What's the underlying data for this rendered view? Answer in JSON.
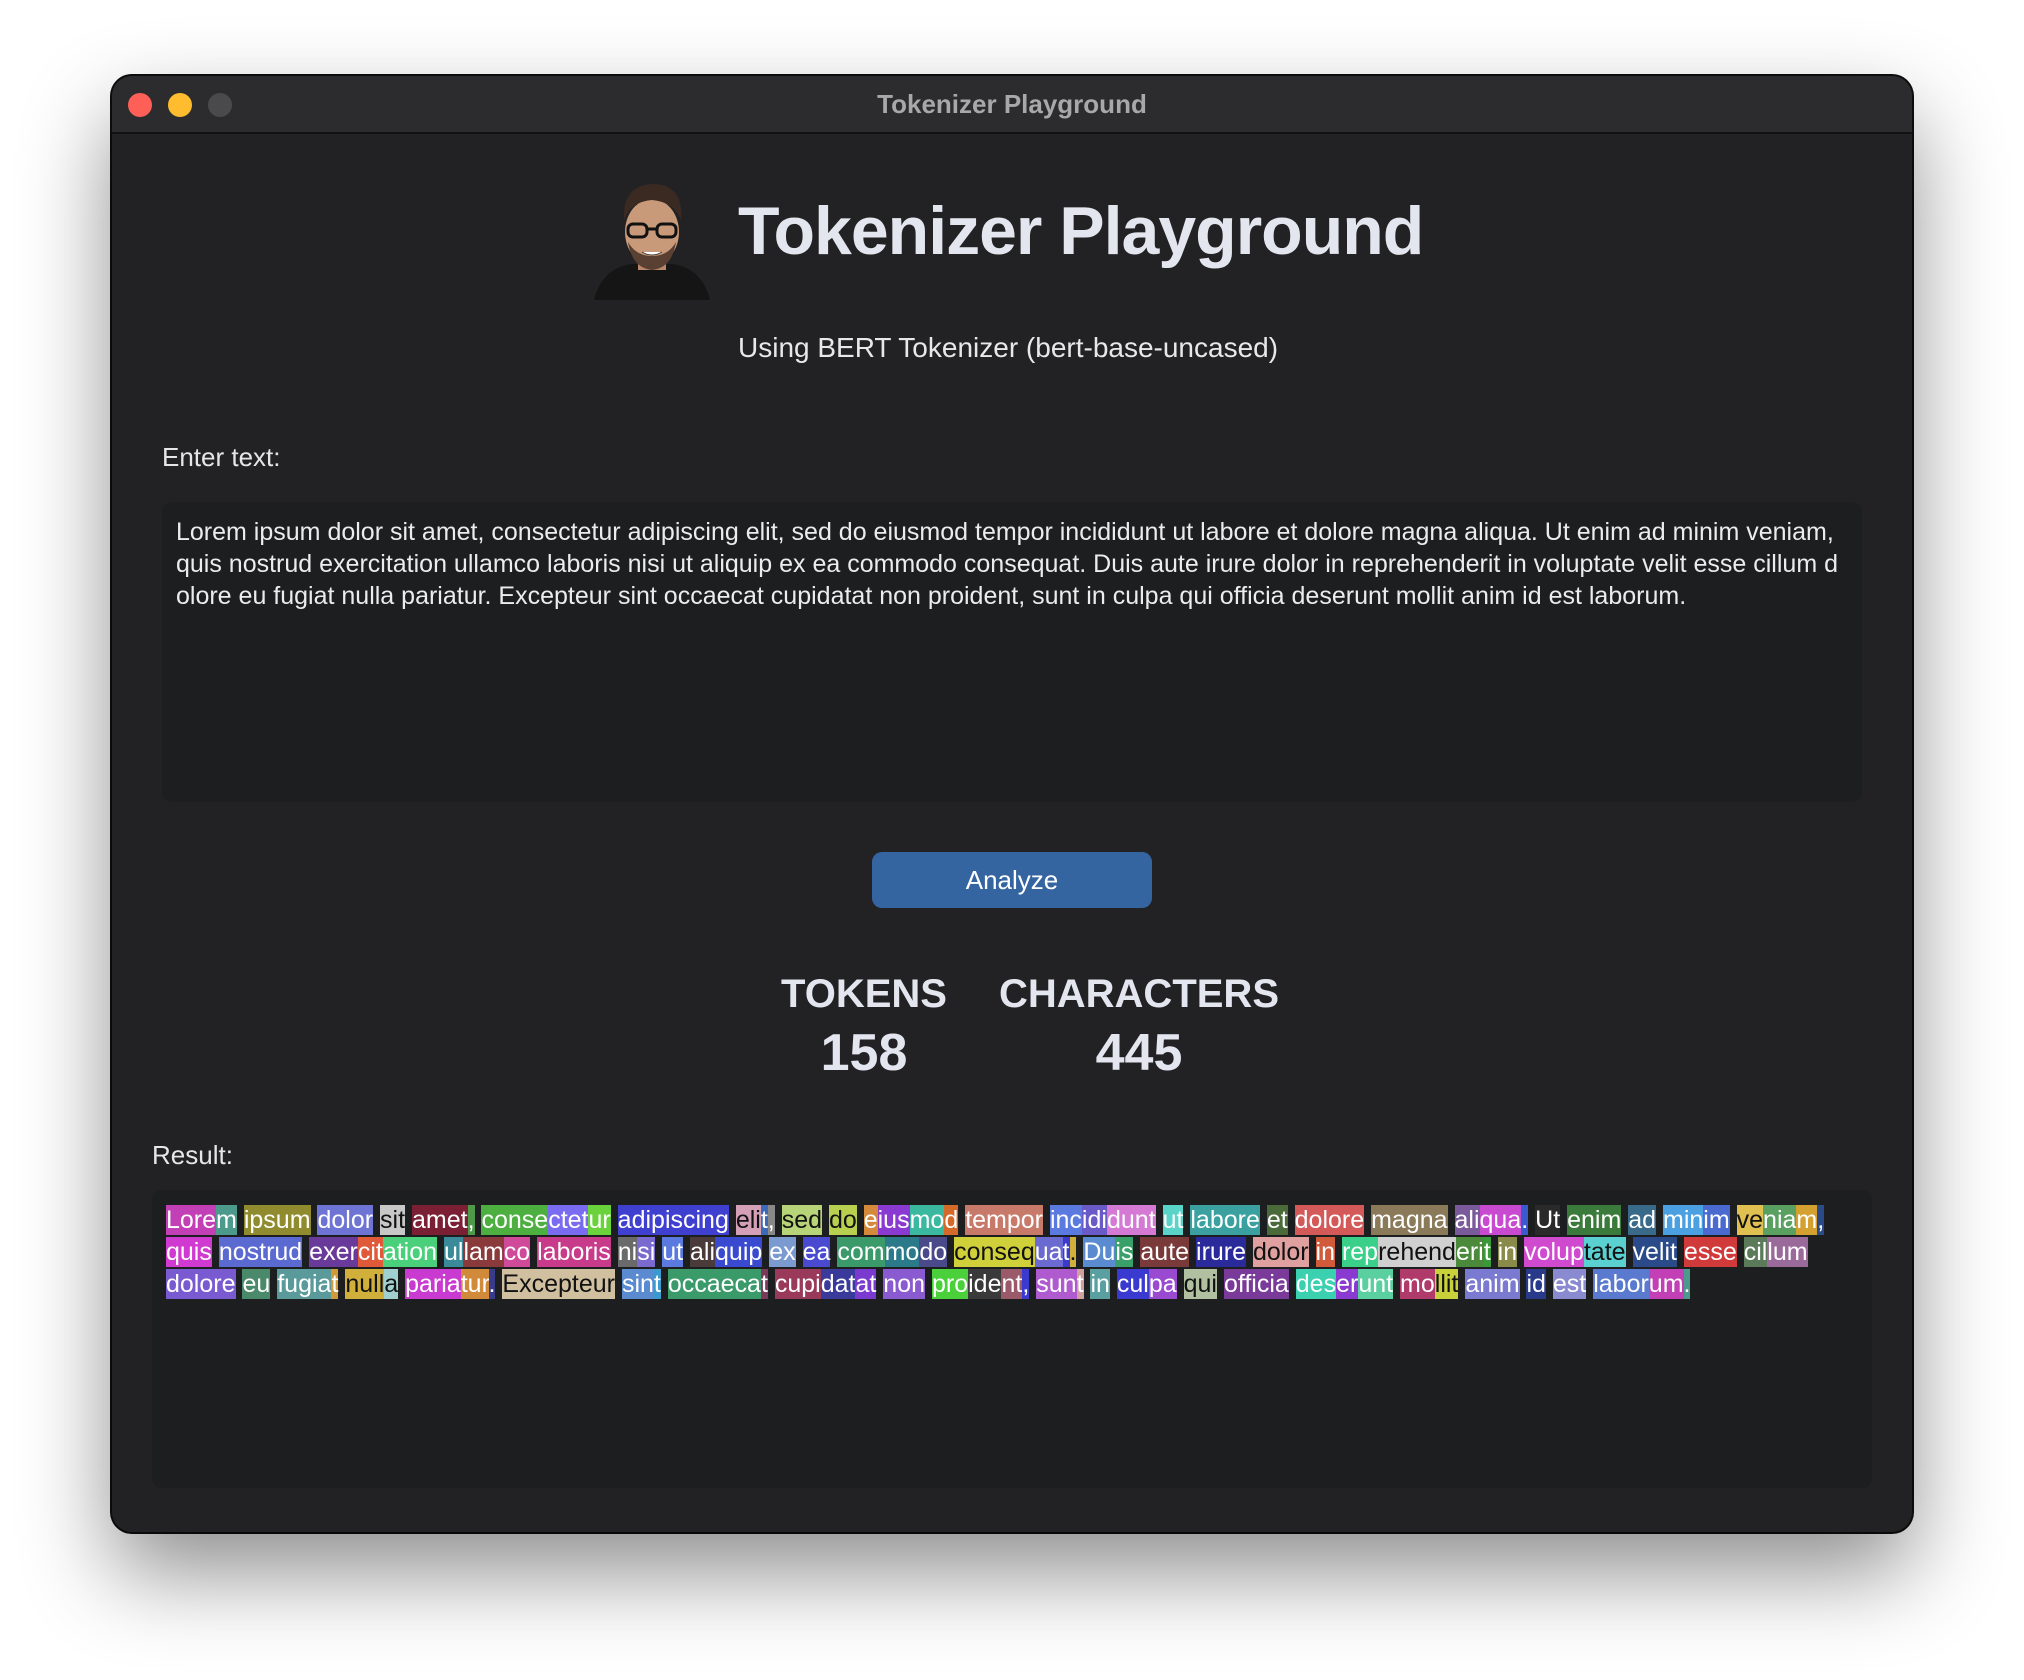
{
  "window": {
    "title": "Tokenizer Playground"
  },
  "header": {
    "title": "Tokenizer Playground",
    "subtitle": "Using BERT Tokenizer (bert-base-uncased)"
  },
  "input": {
    "label": "Enter text:",
    "value": "Lorem ipsum dolor sit amet, consectetur adipiscing elit, sed do eiusmod tempor incididunt ut labore et dolore magna aliqua. Ut enim ad minim veniam, quis nostrud exercitation ullamco laboris nisi ut aliquip ex ea commodo consequat. Duis aute irure dolor in reprehenderit in voluptate velit esse cillum dolore eu fugiat nulla pariatur. Excepteur sint occaecat cupidatat non proident, sunt in culpa qui officia deserunt mollit anim id est laborum."
  },
  "actions": {
    "analyze_label": "Analyze"
  },
  "stats": {
    "tokens_label": "TOKENS",
    "tokens_value": "158",
    "characters_label": "CHARACTERS",
    "characters_value": "445"
  },
  "result": {
    "label": "Result:",
    "tokens": [
      "Lore",
      "m",
      " ipsum",
      " dolor",
      " sit",
      " amet",
      ",",
      " conse",
      "ctet",
      "ur",
      " adipiscing",
      " eli",
      "t",
      ",",
      " sed",
      " do",
      " e",
      "ius",
      "mo",
      "d",
      " tempor",
      " inc",
      "idi",
      "dunt",
      " ut",
      " labore",
      " et",
      " dolore",
      " magna",
      " ali",
      "qua",
      ".",
      " Ut",
      " enim",
      " ad",
      " min",
      "im",
      " ve",
      "nia",
      "m",
      ",",
      " quis",
      " nostrud",
      " exer",
      "cit",
      "ation",
      " ul",
      "lam",
      "co",
      " laboris",
      " ni",
      "si",
      " ut",
      " ali",
      "quip",
      " ex",
      " ea",
      " com",
      "mo",
      "do",
      " conseq",
      "ua",
      "t",
      ".",
      " Du",
      "is",
      " aute",
      " irure",
      " dolor",
      " in",
      " rep",
      "rehend",
      "eri",
      "t",
      " in",
      " volup",
      "tate",
      " velit",
      " esse",
      " cil",
      "lum",
      " dolore",
      " eu",
      " fugia",
      "t",
      " null",
      "a",
      " paria",
      "tur",
      ".",
      " Excepteur",
      " sin",
      "t",
      " occaeca",
      "t",
      " cupi",
      "dat",
      "at",
      " non",
      " pro",
      "ide",
      "nt",
      ",",
      " sun",
      "t",
      " in",
      " cul",
      "pa",
      " qui",
      " officia",
      " des",
      "er",
      "unt",
      " mo",
      "llit",
      " anim",
      " id",
      " est",
      " labor",
      "um",
      "."
    ],
    "colors": [
      "#c23fb5",
      "#4b9a8c",
      "#8f8b2e",
      "#6d74d4",
      "#c8c8c8",
      "#7a1f34",
      "#4f9a48",
      "#4caf3f",
      "#7a6cf0",
      "#6ad23a",
      "#3f3fd0",
      "#d4a0b8",
      "#3a6ab8",
      "#888888",
      "#b8d478",
      "#b8d050",
      "#d48a3a",
      "#8a3ad0",
      "#3ab8a0",
      "#d46a2a",
      "#c87a6a",
      "#5a7ae0",
      "#6a5ac8",
      "#d47ad4",
      "#5ad4c8",
      "#3aa0a0",
      "#4a6a3a",
      "#d45a5a",
      "#8a7a5a",
      "#7a5a9a",
      "#c84ad0",
      "#3a5ad0",
      "#2a2a2a",
      "#3a7a3a",
      "#3a6a8a",
      "#4aa0e0",
      "#4a6ad0",
      "#e0c050",
      "#5aa060",
      "#d4a030",
      "#2a4a8a",
      "#d03ad0",
      "#5a6ad0",
      "#6a3a9a",
      "#e05a3a",
      "#4ad07a",
      "#3a8a9a",
      "#8a3a3a",
      "#d04a9a",
      "#c83a8a",
      "#6a6a6a",
      "#7a6ad0",
      "#5a7ae0",
      "#4a3a3a",
      "#3a4ad0",
      "#7a9ad0",
      "#4a4ad0",
      "#3a9a6a",
      "#2a7a8a",
      "#4a4a8a",
      "#d0d03a",
      "#6a6ad0",
      "#3a3ad0",
      "#d0b03a",
      "#5a8ad0",
      "#3aa06a",
      "#7a3a3a",
      "#2a2a9a",
      "#e0a0a0",
      "#d05a3a",
      "#3ad08a",
      "#d0d0d0",
      "#4a8a3a",
      "#3a9a3a",
      "#8a8a4a",
      "#d04ad0",
      "#5ad0d0",
      "#2a4a8a",
      "#d03a3a",
      "#5a7a5a",
      "#9a6a9a",
      "#7a5ad0",
      "#4a8a6a",
      "#5a9a9a",
      "#d09a3a",
      "#d0b03a",
      "#a0d0d0",
      "#c83ad0",
      "#d08a3a",
      "#3a3a8a",
      "#d0c0a0",
      "#5a8ad0",
      "#3a9ad0",
      "#3a9a6a",
      "#7a3a5a",
      "#9a3a5a",
      "#3a3a9a",
      "#7a3ad0",
      "#8a5ad0",
      "#4ad03a",
      "#3a3a3a",
      "#9a5a6a",
      "#3a3ad0",
      "#b05ad0",
      "#d0a0a0",
      "#5aa0a0",
      "#3a3ad0",
      "#9a4ad0",
      "#b0c0a0",
      "#7a3a9a",
      "#3ad0b0",
      "#8a3ad0",
      "#5ad0a0",
      "#b03a6a",
      "#c8d03a",
      "#7a7ad0",
      "#2a3a8a",
      "#8a8ad0",
      "#5a7ad0"
    ],
    "dark_text": [
      "#c8c8c8",
      "#b8d478",
      "#b8d050",
      "#e0c050",
      "#d0d03a",
      "#d0d0d0",
      "#5ad0d0",
      "#e0a0a0",
      "#d0b03a",
      "#a0d0d0",
      "#d0c0a0",
      "#b0c0a0",
      "#c8d03a",
      "#d4a0b8"
    ]
  }
}
